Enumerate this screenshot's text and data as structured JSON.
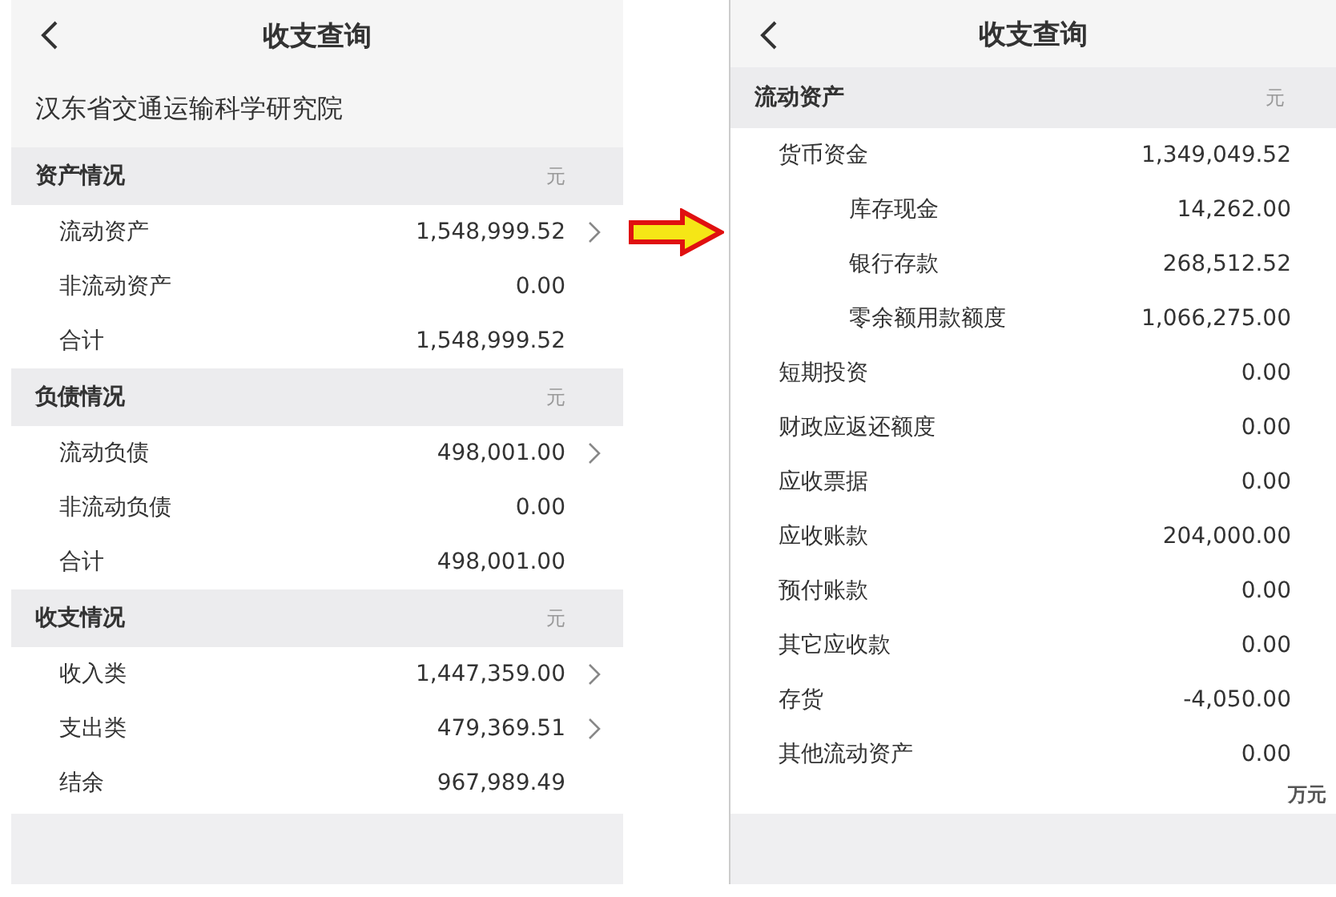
{
  "left": {
    "header": {
      "title": "收支查询"
    },
    "org": "汉东省交通运输科学研究院",
    "sections": [
      {
        "title": "资产情况",
        "unit": "元",
        "rows": [
          {
            "label": "流动资产",
            "value": "1,548,999.52",
            "drilldown": true
          },
          {
            "label": "非流动资产",
            "value": "0.00",
            "drilldown": false
          },
          {
            "label": "合计",
            "value": "1,548,999.52",
            "drilldown": false
          }
        ]
      },
      {
        "title": "负债情况",
        "unit": "元",
        "rows": [
          {
            "label": "流动负债",
            "value": "498,001.00",
            "drilldown": true
          },
          {
            "label": "非流动负债",
            "value": "0.00",
            "drilldown": false
          },
          {
            "label": "合计",
            "value": "498,001.00",
            "drilldown": false
          }
        ]
      },
      {
        "title": "收支情况",
        "unit": "元",
        "rows": [
          {
            "label": "收入类",
            "value": "1,447,359.00",
            "drilldown": true
          },
          {
            "label": "支出类",
            "value": "479,369.51",
            "drilldown": true
          },
          {
            "label": "结余",
            "value": "967,989.49",
            "drilldown": false
          }
        ]
      }
    ]
  },
  "right": {
    "header": {
      "title": "收支查询"
    },
    "section": {
      "title": "流动资产",
      "unit": "元",
      "rows": [
        {
          "label": "货币资金",
          "value": "1,349,049.52",
          "children": [
            {
              "label": "库存现金",
              "value": "14,262.00"
            },
            {
              "label": "银行存款",
              "value": "268,512.52"
            },
            {
              "label": "零余额用款额度",
              "value": "1,066,275.00"
            }
          ]
        },
        {
          "label": "短期投资",
          "value": "0.00"
        },
        {
          "label": "财政应返还额度",
          "value": "0.00"
        },
        {
          "label": "应收票据",
          "value": "0.00"
        },
        {
          "label": "应收账款",
          "value": "204,000.00"
        },
        {
          "label": "预付账款",
          "value": "0.00"
        },
        {
          "label": "其它应收款",
          "value": "0.00"
        },
        {
          "label": "存货",
          "value": "-4,050.00"
        },
        {
          "label": "其他流动资产",
          "value": "0.00"
        }
      ]
    },
    "footer_unit": "万元"
  }
}
